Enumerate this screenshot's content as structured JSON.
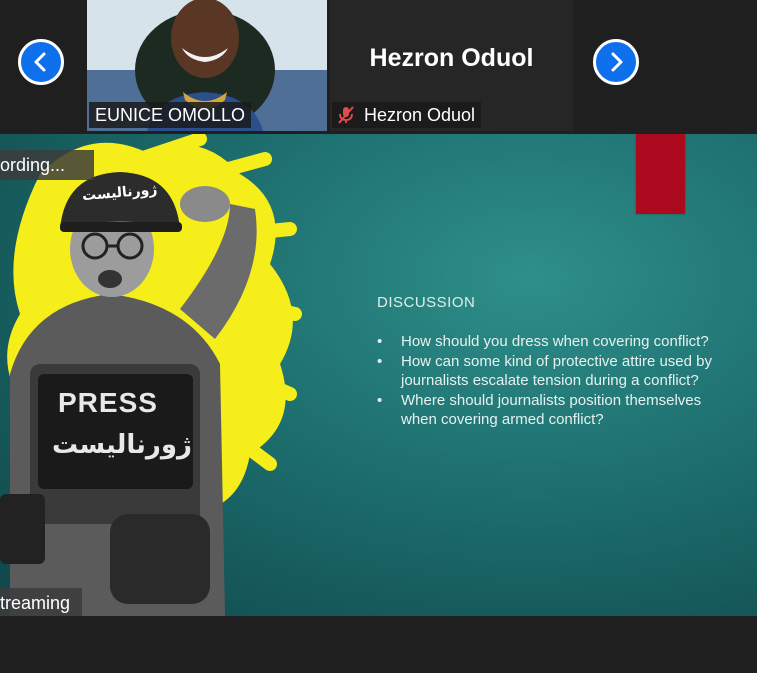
{
  "participants": {
    "prev_icon": "chevron-left-icon",
    "next_icon": "chevron-right-icon",
    "tiles": [
      {
        "name": "EUNICE OMOLLO",
        "video": true
      },
      {
        "name": "Hezron Oduol",
        "display_name": "Hezron Oduol",
        "muted": true,
        "mute_icon": "mic-muted-icon"
      }
    ]
  },
  "slide": {
    "heading": "DISCUSSION",
    "bullets": [
      "How should you dress when covering conflict?",
      "How can some kind of protective attire used by journalists escalate tension during a conflict?",
      "Where should journalists position themselves when covering armed conflict?"
    ],
    "vest_text": "PRESS",
    "vest_text_arabic": "ژورنالیست",
    "helmet_text_arabic": "ژورنالیست"
  },
  "overlays": {
    "recording": "ording...",
    "streaming": "treaming"
  },
  "colors": {
    "accent": "#0e71eb",
    "slide_red": "#ab0a1e",
    "slide_bg": "#1d6e6e",
    "yellow": "#f5ee1a"
  }
}
